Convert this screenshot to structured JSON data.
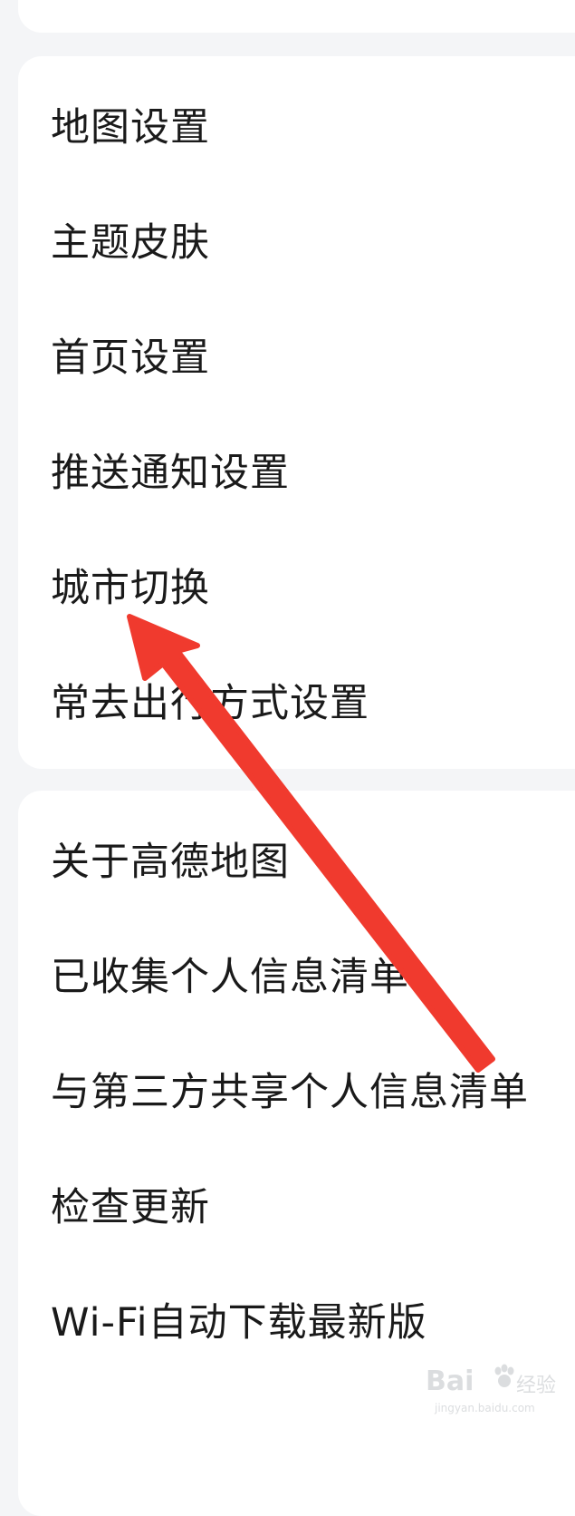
{
  "settings_group_1": {
    "items": [
      {
        "label": "地图设置"
      },
      {
        "label": "主题皮肤"
      },
      {
        "label": "首页设置"
      },
      {
        "label": "推送通知设置"
      },
      {
        "label": "城市切换"
      },
      {
        "label": "常去出行方式设置"
      }
    ]
  },
  "settings_group_2": {
    "items": [
      {
        "label": "关于高德地图"
      },
      {
        "label": "已收集个人信息清单"
      },
      {
        "label": "与第三方共享个人信息清单"
      },
      {
        "label": "检查更新"
      },
      {
        "label": "Wi-Fi自动下载最新版"
      }
    ]
  },
  "annotation": {
    "arrow_color": "#f03a2e",
    "points_to": "城市切换"
  },
  "watermark": {
    "brand": "Bai",
    "suffix": "经验",
    "url": "jingyan.baidu.com"
  }
}
